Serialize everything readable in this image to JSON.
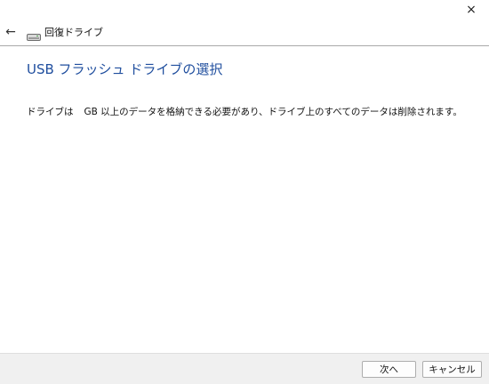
{
  "window": {
    "close_glyph": "×"
  },
  "nav": {
    "back_glyph": "←",
    "breadcrumb": "回復ドライブ"
  },
  "main": {
    "heading": "USB フラッシュ ドライブの選択",
    "message_part1": "ドライブは",
    "message_part2": "GB 以上のデータを格納できる必要があり、ドライブ上のすべてのデータは削除されます。"
  },
  "footer": {
    "next_label": "次へ",
    "cancel_label": "キャンセル"
  },
  "colors": {
    "heading": "#1f4e9e",
    "footer_bg": "#f0f0f0"
  },
  "icons": {
    "back": "back-arrow-icon",
    "drive": "drive-icon",
    "close": "close-icon"
  }
}
